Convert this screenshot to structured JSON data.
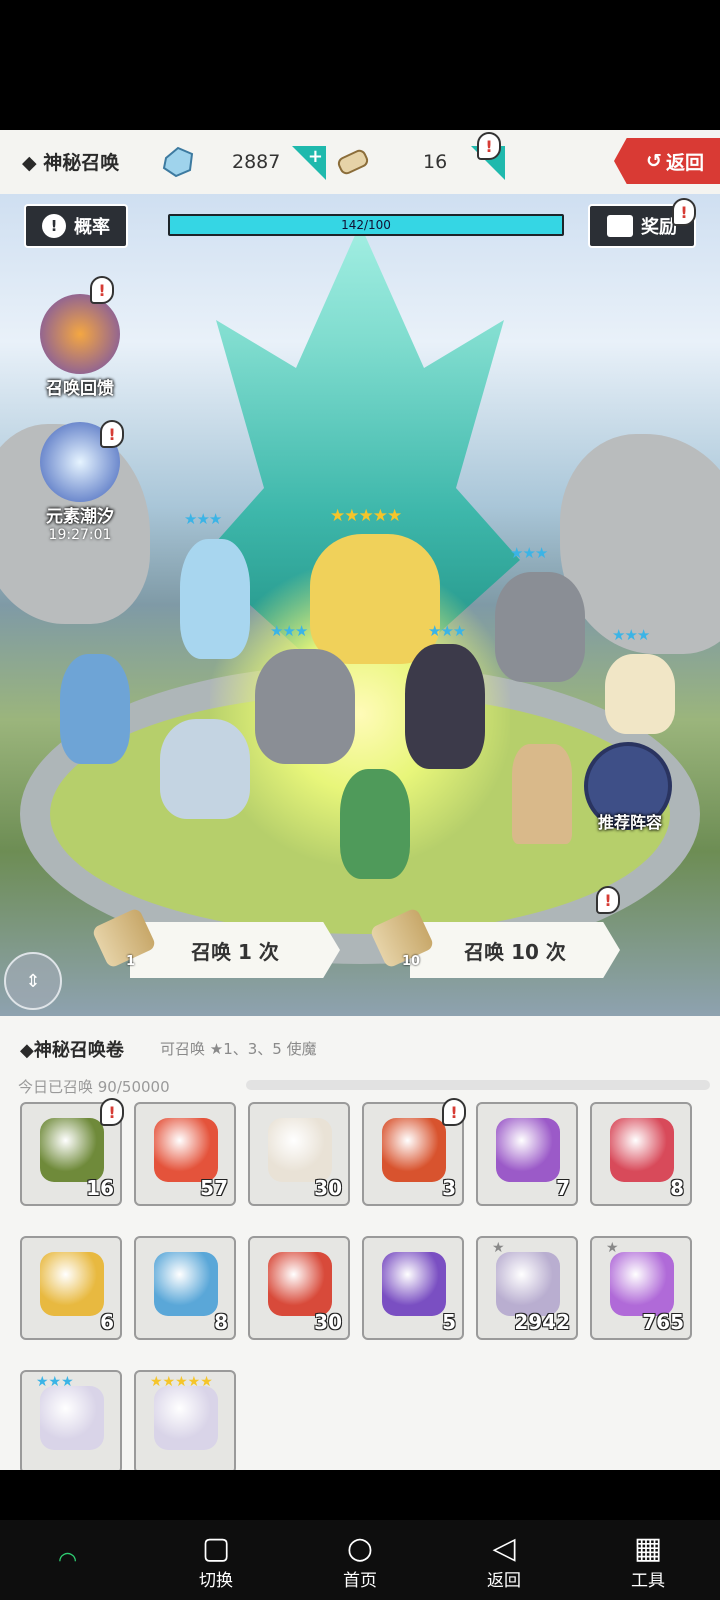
{
  "header": {
    "title": "◆ 神秘召唤",
    "gems": "2887",
    "scrolls": "16",
    "back_label": "返回"
  },
  "scene": {
    "rate_label": "概率",
    "progress_text": "142/100",
    "progress_ratio": 1.0,
    "reward_label": "奖励",
    "side_items": [
      {
        "label": "召唤回馈"
      },
      {
        "label": "元素潮汐",
        "time": "19:27:01"
      }
    ],
    "recommend_label": "推荐阵容",
    "summon_once_label": "召唤 1 次",
    "summon_once_cost": "1",
    "summon_ten_label": "召唤 10 次",
    "summon_ten_cost": "10",
    "star_groups": [
      "★★★",
      "★★★★★",
      "★★★",
      "★★★",
      "★★★",
      "★★★"
    ]
  },
  "panel": {
    "title": "◆神秘召唤卷",
    "subtitle": "可召唤 ★1、3、5 使魔",
    "daily_label": "今日已召唤 90/50000",
    "daily_ratio": 0.0018,
    "items": [
      {
        "count": "16",
        "color": "#6f8a3a",
        "icon": "checked-scroll-icon",
        "badge": true
      },
      {
        "count": "57",
        "color": "#e4533b",
        "icon": "heart-icon"
      },
      {
        "count": "30",
        "color": "#e9e2d6",
        "icon": "pearl-shell-icon"
      },
      {
        "count": "3",
        "color": "#d8532e",
        "icon": "red-orb-icon",
        "badge": true
      },
      {
        "count": "7",
        "color": "#9b5ac8",
        "icon": "purple-scroll-icon"
      },
      {
        "count": "8",
        "color": "#d84a5a",
        "icon": "red-scroll-icon"
      },
      {
        "count": "6",
        "color": "#e8b940",
        "icon": "gold-scroll-icon"
      },
      {
        "count": "8",
        "color": "#5aa7d8",
        "icon": "blue-scroll-icon"
      },
      {
        "count": "30",
        "color": "#d84a3a",
        "icon": "red-gold-orb-icon"
      },
      {
        "count": "5",
        "color": "#7a4fc2",
        "icon": "purple-orb-icon"
      },
      {
        "count": "2942",
        "color": "#b9aed0",
        "icon": "gray-shard-icon",
        "stars": "★"
      },
      {
        "count": "765",
        "color": "#b06ad8",
        "icon": "purple-shard-icon",
        "stars": "★"
      },
      {
        "count": "",
        "color": "#d9d4e8",
        "icon": "blue-star-relic-icon",
        "stars": "★★★"
      },
      {
        "count": "",
        "color": "#d9d4e8",
        "icon": "gold-star-relic-icon",
        "stars": "★★★★★"
      }
    ]
  },
  "nav": {
    "switch": "切换",
    "home": "首页",
    "back": "返回",
    "tools": "工具"
  }
}
